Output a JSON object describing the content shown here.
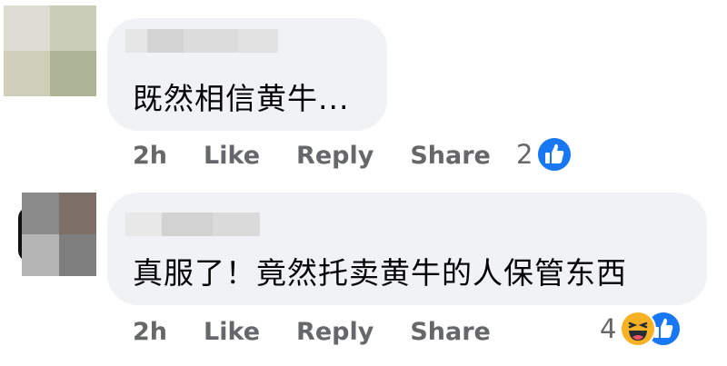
{
  "comments": [
    {
      "text": "既然相信黄牛...",
      "timestamp": "2h",
      "like_label": "Like",
      "reply_label": "Reply",
      "share_label": "Share",
      "reaction_count": "2",
      "reactions": [
        "like-icon"
      ]
    },
    {
      "text": "真服了！竟然托卖黄牛的人保管东西",
      "timestamp": "2h",
      "like_label": "Like",
      "reply_label": "Reply",
      "share_label": "Share",
      "reaction_count": "4",
      "reactions": [
        "haha-icon",
        "like-icon"
      ]
    }
  ],
  "colors": {
    "bubble": "#f0f2f5",
    "action_text": "#65676b",
    "like_blue": "#1877f2",
    "haha_yellow": "#f7b125"
  }
}
